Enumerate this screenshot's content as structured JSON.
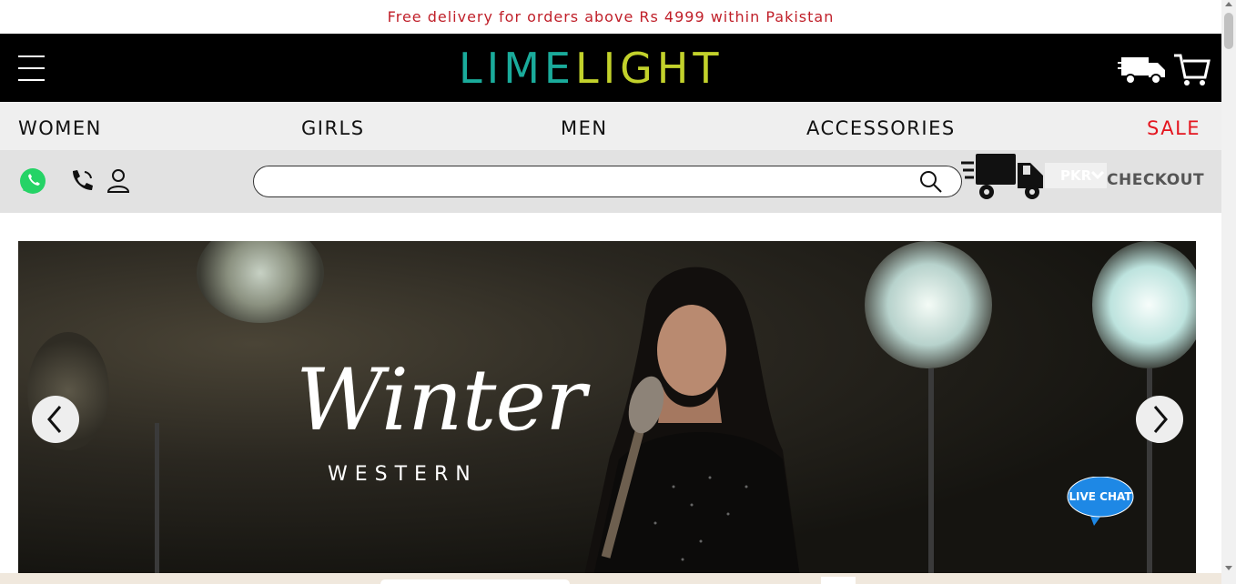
{
  "promo": {
    "text": "Free delivery for orders above Rs 4999 within Pakistan"
  },
  "header": {
    "logo_part1": "LIM",
    "logo_part2": "LIGHT",
    "logo_mid": "E",
    "colors": {
      "teal": "#1aab9b",
      "lime": "#c2d12b",
      "background": "#000000"
    }
  },
  "nav": {
    "items": [
      {
        "label": "WOMEN"
      },
      {
        "label": "GIRLS"
      },
      {
        "label": "MEN"
      },
      {
        "label": "ACCESSORIES"
      },
      {
        "label": "SALE",
        "color": "#e4151f"
      }
    ]
  },
  "toolbar": {
    "search_placeholder": "",
    "currency": "PKR",
    "checkout": "CHECKOUT",
    "icons": [
      "whatsapp-icon",
      "phone-icon",
      "user-icon",
      "search-icon",
      "delivery-truck-icon",
      "chevron-down-icon"
    ]
  },
  "hero": {
    "title": "Winter",
    "subtitle": "WESTERN"
  },
  "livechat": {
    "label": "LIVE CHAT"
  }
}
